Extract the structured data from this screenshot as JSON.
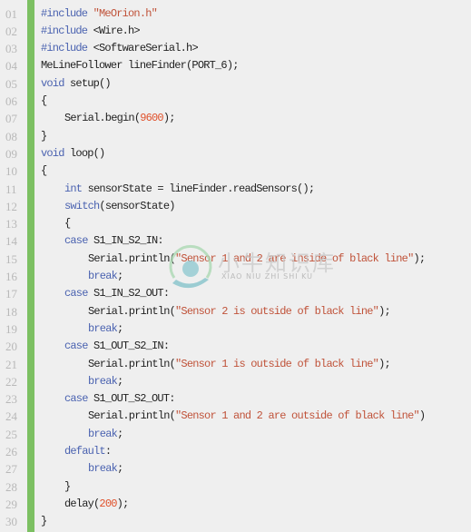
{
  "editor": {
    "accent_bar_color": "#7cc062",
    "token_colors": {
      "kw": "#4a62b0",
      "str": "#c0533a",
      "num": "#e0502a",
      "plain": "#222222"
    },
    "lines": [
      {
        "no": "01",
        "indent": 0,
        "tokens": [
          [
            "kw",
            "#include "
          ],
          [
            "str",
            "\"MeOrion.h\""
          ]
        ]
      },
      {
        "no": "02",
        "indent": 0,
        "tokens": [
          [
            "kw",
            "#include "
          ],
          [
            "plain",
            "<Wire.h>"
          ]
        ]
      },
      {
        "no": "03",
        "indent": 0,
        "tokens": [
          [
            "kw",
            "#include "
          ],
          [
            "plain",
            "<SoftwareSerial.h>"
          ]
        ]
      },
      {
        "no": "04",
        "indent": 0,
        "tokens": [
          [
            "plain",
            "MeLineFollower lineFinder(PORT_6);"
          ]
        ]
      },
      {
        "no": "05",
        "indent": 0,
        "tokens": [
          [
            "kw",
            "void "
          ],
          [
            "plain",
            "setup()"
          ]
        ]
      },
      {
        "no": "06",
        "indent": 0,
        "tokens": [
          [
            "plain",
            "{"
          ]
        ]
      },
      {
        "no": "07",
        "indent": 1,
        "tokens": [
          [
            "plain",
            "Serial.begin("
          ],
          [
            "num",
            "9600"
          ],
          [
            "plain",
            ");"
          ]
        ]
      },
      {
        "no": "08",
        "indent": 0,
        "tokens": [
          [
            "plain",
            "}"
          ]
        ]
      },
      {
        "no": "09",
        "indent": 0,
        "tokens": [
          [
            "kw",
            "void "
          ],
          [
            "plain",
            "loop()"
          ]
        ]
      },
      {
        "no": "10",
        "indent": 0,
        "tokens": [
          [
            "plain",
            "{"
          ]
        ]
      },
      {
        "no": "11",
        "indent": 1,
        "tokens": [
          [
            "kw",
            "int "
          ],
          [
            "plain",
            "sensorState = lineFinder.readSensors();"
          ]
        ]
      },
      {
        "no": "12",
        "indent": 1,
        "tokens": [
          [
            "kw",
            "switch"
          ],
          [
            "plain",
            "(sensorState)"
          ]
        ]
      },
      {
        "no": "13",
        "indent": 1,
        "tokens": [
          [
            "plain",
            "{"
          ]
        ]
      },
      {
        "no": "14",
        "indent": 1,
        "tokens": [
          [
            "kw",
            "case "
          ],
          [
            "plain",
            "S1_IN_S2_IN:"
          ]
        ]
      },
      {
        "no": "15",
        "indent": 2,
        "tokens": [
          [
            "plain",
            "Serial.println("
          ],
          [
            "str",
            "\"Sensor 1 and 2 are inside of black line\""
          ],
          [
            "plain",
            ");"
          ]
        ]
      },
      {
        "no": "16",
        "indent": 2,
        "tokens": [
          [
            "kw",
            "break"
          ],
          [
            "plain",
            ";"
          ]
        ]
      },
      {
        "no": "17",
        "indent": 1,
        "tokens": [
          [
            "kw",
            "case "
          ],
          [
            "plain",
            "S1_IN_S2_OUT:"
          ]
        ]
      },
      {
        "no": "18",
        "indent": 2,
        "tokens": [
          [
            "plain",
            "Serial.println("
          ],
          [
            "str",
            "\"Sensor 2 is outside of black line\""
          ],
          [
            "plain",
            ");"
          ]
        ]
      },
      {
        "no": "19",
        "indent": 2,
        "tokens": [
          [
            "kw",
            "break"
          ],
          [
            "plain",
            ";"
          ]
        ]
      },
      {
        "no": "20",
        "indent": 1,
        "tokens": [
          [
            "kw",
            "case "
          ],
          [
            "plain",
            "S1_OUT_S2_IN:"
          ]
        ]
      },
      {
        "no": "21",
        "indent": 2,
        "tokens": [
          [
            "plain",
            "Serial.println("
          ],
          [
            "str",
            "\"Sensor 1 is outside of black line\""
          ],
          [
            "plain",
            ");"
          ]
        ]
      },
      {
        "no": "22",
        "indent": 2,
        "tokens": [
          [
            "kw",
            "break"
          ],
          [
            "plain",
            ";"
          ]
        ]
      },
      {
        "no": "23",
        "indent": 1,
        "tokens": [
          [
            "kw",
            "case "
          ],
          [
            "plain",
            "S1_OUT_S2_OUT:"
          ]
        ]
      },
      {
        "no": "24",
        "indent": 2,
        "tokens": [
          [
            "plain",
            "Serial.println("
          ],
          [
            "str",
            "\"Sensor 1 and 2 are outside of black line\""
          ],
          [
            "plain",
            ")"
          ]
        ]
      },
      {
        "no": "25",
        "indent": 2,
        "tokens": [
          [
            "kw",
            "break"
          ],
          [
            "plain",
            ";"
          ]
        ]
      },
      {
        "no": "26",
        "indent": 1,
        "tokens": [
          [
            "kw",
            "default"
          ],
          [
            "plain",
            ":"
          ]
        ]
      },
      {
        "no": "27",
        "indent": 2,
        "tokens": [
          [
            "kw",
            "break"
          ],
          [
            "plain",
            ";"
          ]
        ]
      },
      {
        "no": "28",
        "indent": 1,
        "tokens": [
          [
            "plain",
            "}"
          ]
        ]
      },
      {
        "no": "29",
        "indent": 1,
        "tokens": [
          [
            "plain",
            "delay("
          ],
          [
            "num",
            "200"
          ],
          [
            "plain",
            ");"
          ]
        ]
      },
      {
        "no": "30",
        "indent": 0,
        "tokens": [
          [
            "plain",
            "}"
          ]
        ]
      }
    ]
  },
  "watermark": {
    "cn": "小牛知识库",
    "en": "XIAO NIU ZHI SHI KU"
  }
}
